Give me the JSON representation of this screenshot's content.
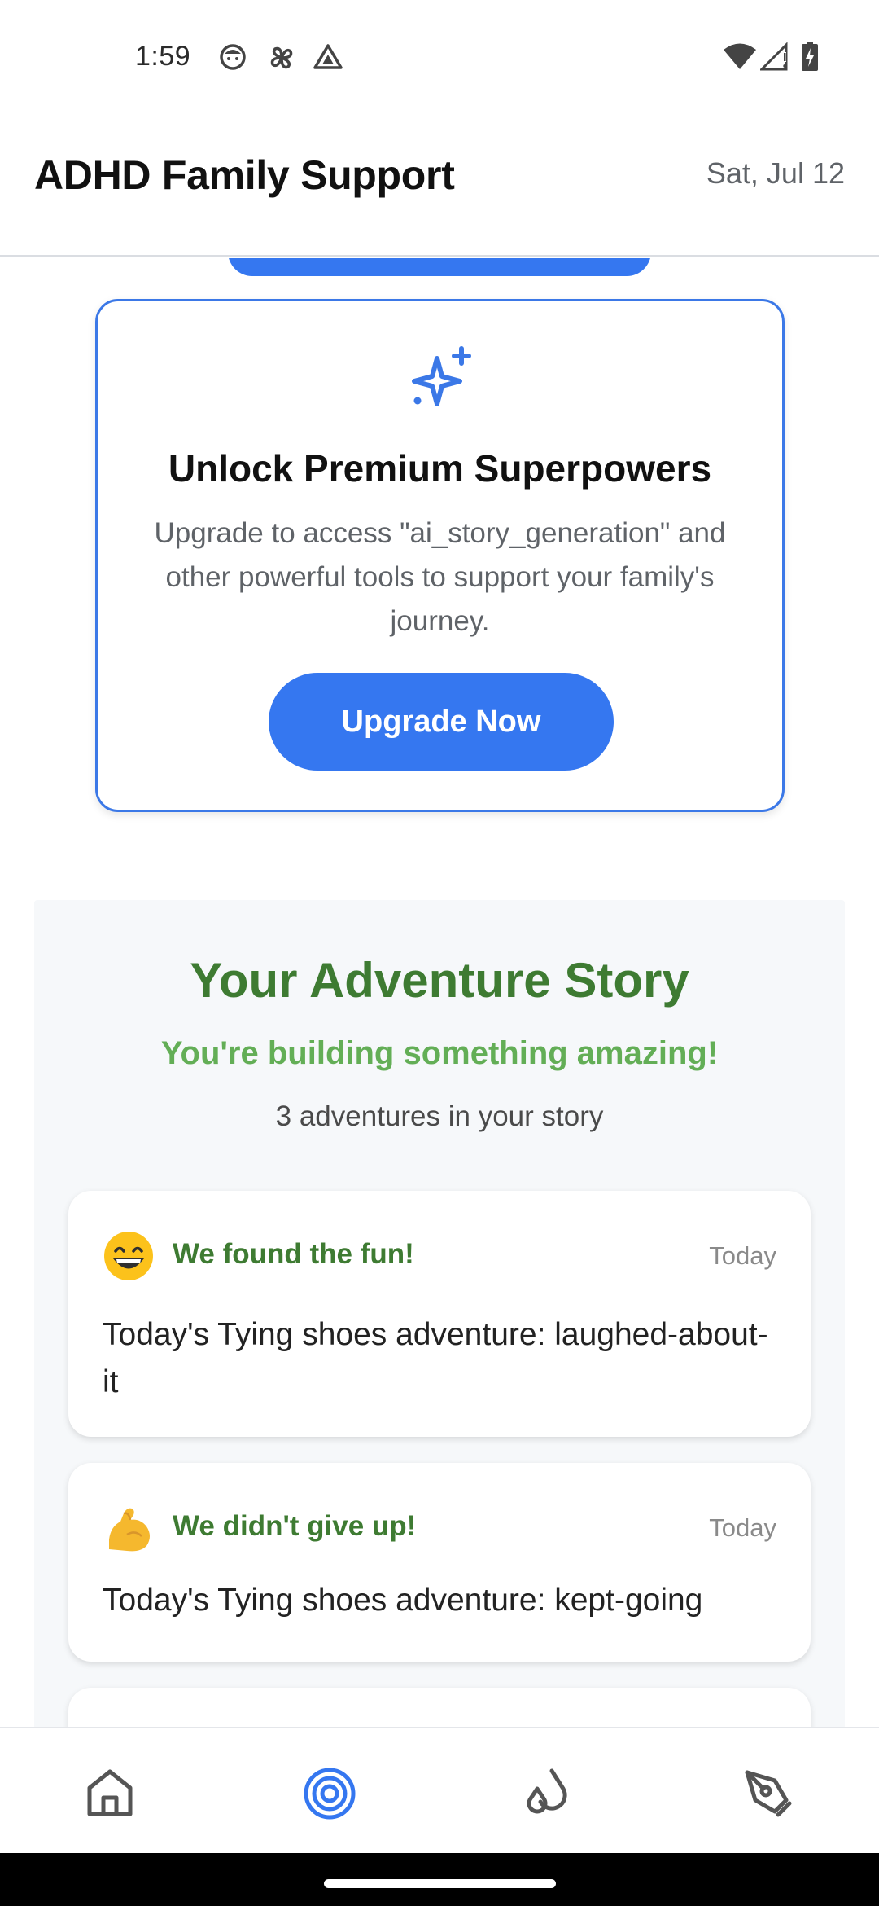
{
  "status_bar": {
    "time": "1:59",
    "left_icons": [
      "face-icon",
      "pinwheel-icon",
      "triangle-icon"
    ],
    "right_icons": [
      "wifi-icon",
      "cellular-signal-icon",
      "battery-charging-icon"
    ]
  },
  "header": {
    "title": "ADHD Family Support",
    "date": "Sat, Jul 12"
  },
  "premium": {
    "icon": "sparkle-icon",
    "title": "Unlock Premium Superpowers",
    "description": "Upgrade to access \"ai_story_generation\" and other powerful tools to support your family's journey.",
    "button_label": "Upgrade Now"
  },
  "story": {
    "title": "Your Adventure Story",
    "subtitle": "You're building something amazing!",
    "count_text": "3 adventures in your story",
    "entries": [
      {
        "emoji": "😄",
        "heading": "We found the fun!",
        "date": "Today",
        "text": "Today's Tying shoes adventure: laughed-about-it"
      },
      {
        "emoji": "💪",
        "heading": "We didn't give up!",
        "date": "Today",
        "text": "Today's Tying shoes adventure: kept-going"
      }
    ]
  },
  "bottom_nav": {
    "items": [
      {
        "icon": "home-icon",
        "active": false
      },
      {
        "icon": "target-icon",
        "active": true
      },
      {
        "icon": "drops-icon",
        "active": false
      },
      {
        "icon": "pen-tool-icon",
        "active": false
      }
    ]
  },
  "colors": {
    "accent": "#3577f0",
    "story_green": "#3e7b32",
    "subtitle_green": "#63ae56",
    "nav_inactive": "#555555"
  }
}
